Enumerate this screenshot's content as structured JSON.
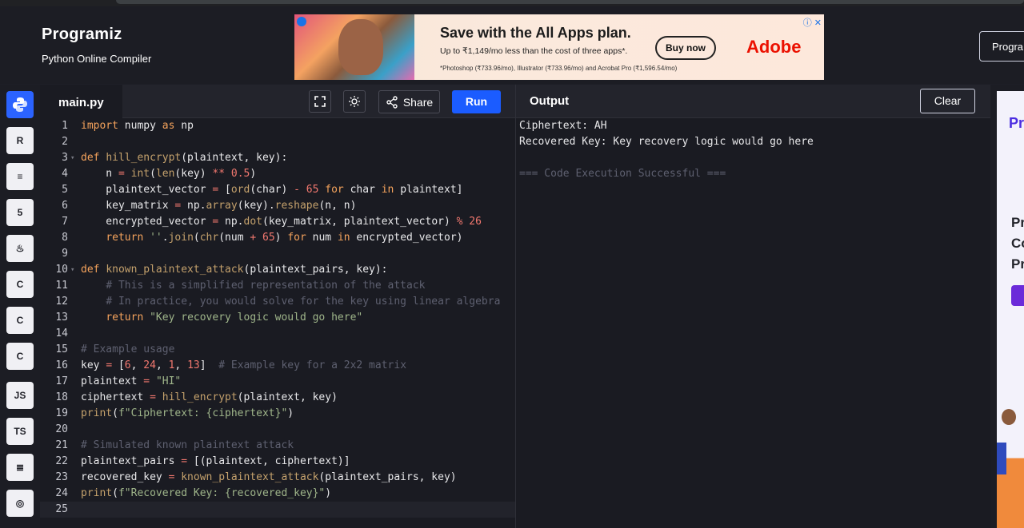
{
  "header": {
    "logo": "Programiz",
    "subtitle": "Python Online Compiler",
    "pro_button": "Progra"
  },
  "ad": {
    "title": "Save with the All Apps plan.",
    "line": "Up to ₹1,149/mo less than the cost of three apps*.",
    "fine": "*Photoshop (₹733.96/mo), Illustrator (₹733.96/mo) and Acrobat Pro (₹1,596.54/mo)",
    "button": "Buy now",
    "brand": "Adobe",
    "close": "ⓘ ✕"
  },
  "sidebar": {
    "items": [
      {
        "name": "python",
        "label": "py",
        "icon": "python-icon",
        "active": true
      },
      {
        "name": "r",
        "label": "R",
        "icon": "r-icon"
      },
      {
        "name": "sql",
        "label": "≡",
        "icon": "database-icon"
      },
      {
        "name": "html",
        "label": "5",
        "icon": "html5-icon"
      },
      {
        "name": "java",
        "label": "♨",
        "icon": "java-icon"
      },
      {
        "name": "c",
        "label": "C",
        "icon": "c-icon"
      },
      {
        "name": "cpp",
        "label": "C",
        "icon": "cpp-icon"
      },
      {
        "name": "csharp",
        "label": "C",
        "icon": "csharp-icon"
      },
      {
        "name": "js",
        "label": "JS",
        "icon": "javascript-icon"
      },
      {
        "name": "ts",
        "label": "TS",
        "icon": "typescript-icon"
      },
      {
        "name": "stack",
        "label": "≣",
        "icon": "stack-icon"
      },
      {
        "name": "swift",
        "label": "◎",
        "icon": "swift-icon"
      }
    ]
  },
  "editor": {
    "file_name": "main.py",
    "share_label": "Share",
    "run_label": "Run",
    "lines": [
      "import numpy as np",
      "",
      "def hill_encrypt(plaintext, key):",
      "    n = int(len(key) ** 0.5)",
      "    plaintext_vector = [ord(char) - 65 for char in plaintext]",
      "    key_matrix = np.array(key).reshape(n, n)",
      "    encrypted_vector = np.dot(key_matrix, plaintext_vector) % 26",
      "    return ''.join(chr(num + 65) for num in encrypted_vector)",
      "",
      "def known_plaintext_attack(plaintext_pairs, key):",
      "    # This is a simplified representation of the attack",
      "    # In practice, you would solve for the key using linear algebra",
      "    return \"Key recovery logic would go here\"",
      "",
      "# Example usage",
      "key = [6, 24, 1, 13]  # Example key for a 2x2 matrix",
      "plaintext = \"HI\"",
      "ciphertext = hill_encrypt(plaintext, key)",
      "print(f\"Ciphertext: {ciphertext}\")",
      "",
      "# Simulated known plaintext attack",
      "plaintext_pairs = [(plaintext, ciphertext)]",
      "recovered_key = known_plaintext_attack(plaintext_pairs, key)",
      "print(f\"Recovered Key: {recovered_key}\")",
      ""
    ]
  },
  "output": {
    "title": "Output",
    "clear_label": "Clear",
    "lines": [
      "Ciphertext: AH",
      "Recovered Key: Key recovery logic would go here",
      "",
      "=== Code Execution Successful ==="
    ]
  },
  "side_ad": {
    "t1": "Pro",
    "t2": "Pr\nCo\nPr"
  },
  "colors": {
    "run": "#1b5cff",
    "active_lang": "#2b63ff",
    "keyword": "#f5a35c",
    "string": "#9fb58a",
    "number": "#f2786f",
    "comment": "#5e6070"
  }
}
